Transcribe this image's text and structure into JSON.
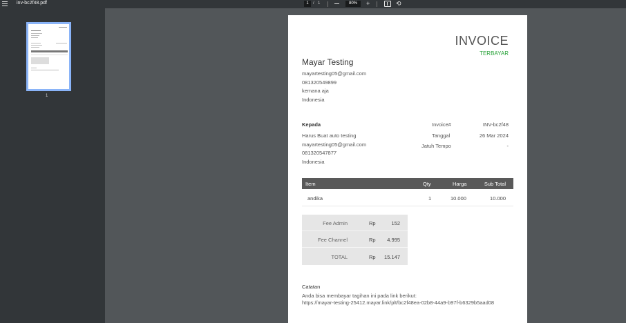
{
  "toolbar": {
    "file_name": "inv-bc2f48.pdf",
    "current_page": "1",
    "page_separator": "/",
    "total_pages": "1",
    "zoom": "80%",
    "menu_icon": "hamburger-icon",
    "zoom_out_icon": "minus-icon",
    "zoom_in_icon": "plus-icon",
    "fit_icon": "fit-to-page-icon",
    "rotate_icon": "rotate-icon"
  },
  "sidebar": {
    "thumbnail_page_number": "1"
  },
  "invoice": {
    "title": "INVOICE",
    "status": "TERBAYAR",
    "merchant": {
      "name": "Mayar Testing",
      "email": "mayartesting05@gmail.com",
      "phone": "081320549899",
      "address": "kemana aja",
      "country": "Indonesia"
    },
    "bill_to": {
      "label": "Kepada",
      "name": "Harus Buat auto testing",
      "email": "mayartesting05@gmail.com",
      "phone": "081320547877",
      "country": "Indonesia"
    },
    "meta": {
      "invoice_label": "Invoice#",
      "invoice_value": "INV-bc2f48",
      "date_label": "Tanggal",
      "date_value": "26 Mar 2024",
      "due_label": "Jatuh Tempo",
      "due_value": "-"
    },
    "table": {
      "headers": {
        "item": "Item",
        "qty": "Qty",
        "price": "Harga",
        "subtotal": "Sub Total"
      },
      "rows": [
        {
          "item": "andika",
          "qty": "1",
          "price": "10.000",
          "subtotal": "10.000"
        }
      ]
    },
    "summary": {
      "rows": [
        {
          "label": "Fee Admin",
          "currency": "Rp",
          "value": "152"
        },
        {
          "label": "Fee Channel",
          "currency": "Rp",
          "value": "4.995"
        },
        {
          "label": "TOTAL",
          "currency": "Rp",
          "value": "15.147"
        }
      ]
    },
    "notes": {
      "label": "Catatan",
      "line1": "Anda bisa membayar tagihan ini pada link berikut:",
      "line2": "https://mayar-testing-25412.mayar.link/plt/bc2f48ea-02b8-44a9-b97f-b6329b5aad08"
    }
  },
  "colors": {
    "toolbar_bg": "#323639",
    "viewer_bg": "#525659",
    "status_green": "#2aa33a",
    "table_header": "#595959",
    "summary_bg": "#e6e6e6",
    "thumb_border": "#8ab4f8"
  }
}
